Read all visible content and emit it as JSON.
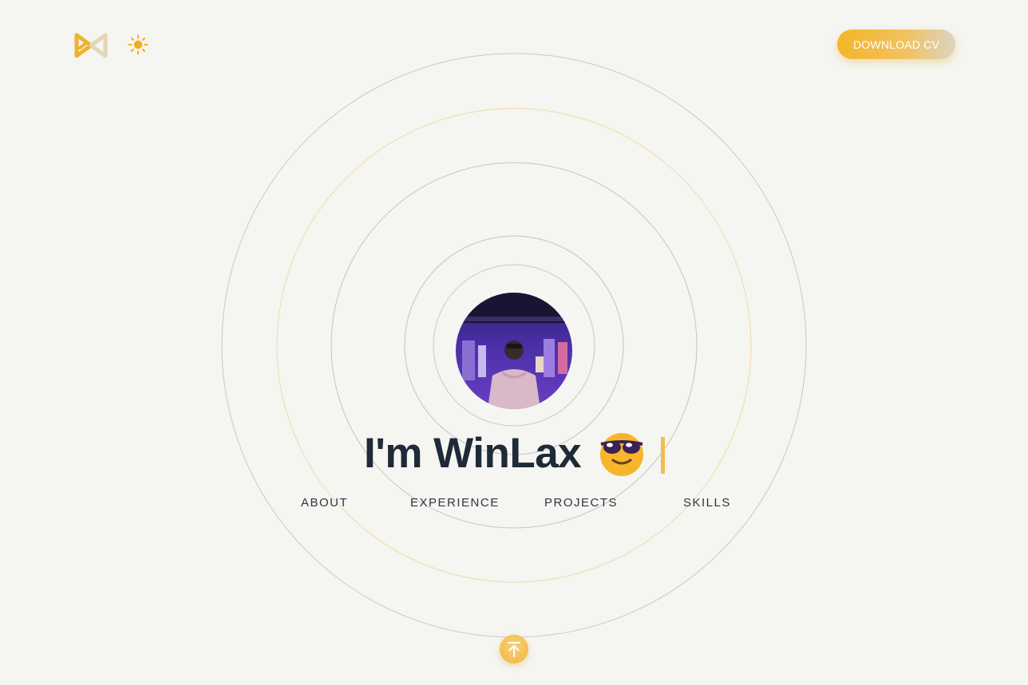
{
  "header": {
    "logo_icon": "infinity-bowtie-logo",
    "theme_icon": "sun-icon",
    "download_cv_label": "DOWNLOAD CV"
  },
  "hero": {
    "headline": "I'm WinLax",
    "emoji": "smiling-face-with-sunglasses",
    "avatar_alt": "profile photo"
  },
  "nav": {
    "items": [
      {
        "label": "ABOUT"
      },
      {
        "label": "EXPERIENCE"
      },
      {
        "label": "PROJECTS"
      },
      {
        "label": "SKILLS"
      }
    ]
  },
  "scroll_top_icon": "arrow-up-to-line-icon",
  "colors": {
    "background": "#f5f5f1",
    "accent": "#f2b32d",
    "text": "#1e2a38",
    "ring_gray": "#c9c9c4",
    "ring_gold": "#f1dba8"
  }
}
